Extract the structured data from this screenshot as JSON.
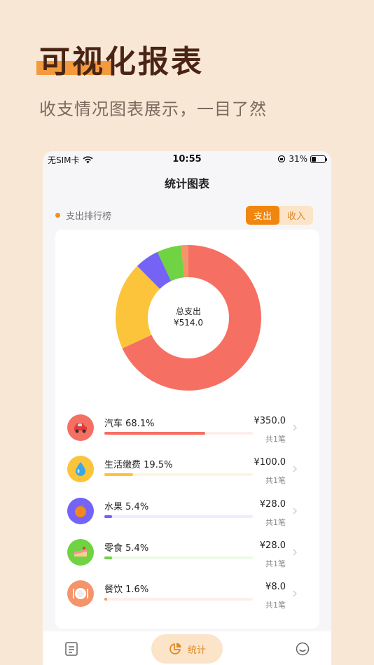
{
  "promo": {
    "title": "可视化报表",
    "subtitle": "收支情况图表展示，一目了然"
  },
  "status_bar": {
    "carrier": "无SIM卡",
    "time": "10:55",
    "battery": "31%",
    "battery_level": 0.31
  },
  "nav": {
    "title": "统计图表"
  },
  "ranking": {
    "title": "支出排行榜",
    "toggle": {
      "expense": "支出",
      "income": "收入",
      "active": "expense"
    }
  },
  "donut": {
    "center_label": "总支出",
    "center_value": "¥514.0"
  },
  "categories": [
    {
      "name": "汽车",
      "percent": "68.1%",
      "fraction": 0.681,
      "amount": "¥350.0",
      "count": "共1笔",
      "color": "#f66f63",
      "track": "#fdeeee",
      "icon": "car-icon"
    },
    {
      "name": "生活缴费",
      "percent": "19.5%",
      "fraction": 0.195,
      "amount": "¥100.0",
      "count": "共1笔",
      "color": "#fbc43a",
      "track": "#fdf5e1",
      "icon": "water-drop-icon"
    },
    {
      "name": "水果",
      "percent": "5.4%",
      "fraction": 0.054,
      "amount": "¥28.0",
      "count": "共1笔",
      "color": "#7563f5",
      "track": "#efedfd",
      "icon": "orange-fruit-icon"
    },
    {
      "name": "零食",
      "percent": "5.4%",
      "fraction": 0.054,
      "amount": "¥28.0",
      "count": "共1笔",
      "color": "#6fd343",
      "track": "#edf9e6",
      "icon": "cake-icon"
    },
    {
      "name": "餐饮",
      "percent": "1.6%",
      "fraction": 0.016,
      "amount": "¥8.0",
      "count": "共1笔",
      "color": "#f5946a",
      "track": "#fdefe8",
      "icon": "plate-icon"
    }
  ],
  "tabbar": {
    "bill_icon": "bill-icon",
    "stats_label": "统计",
    "stats_icon": "pie-chart-icon",
    "me_icon": "smile-icon"
  },
  "colors": {
    "accent": "#f0860f",
    "promo_title": "#4a2414",
    "promo_highlight": "#f39a3c",
    "page_background": "#f9e7d6"
  }
}
